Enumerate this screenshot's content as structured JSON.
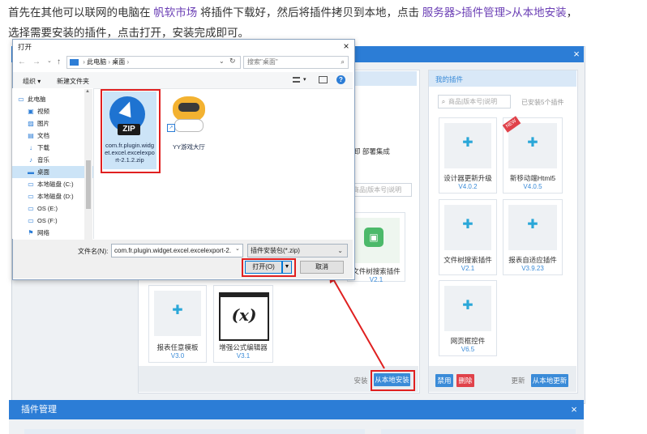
{
  "instruction": {
    "line1_prefix": "首先在其他可以联网的电脑在",
    "link_market": "帆软市场",
    "line1_mid": "将插件下载好，然后将插件拷贝到本地，点击",
    "link_path": "服务器>插件管理>从本地安装",
    "line1_suffix": "，",
    "line2": "选择需要安装的插件，点击打开，安装完成即可。"
  },
  "plugin_manager": {
    "title": "插件管理",
    "my_plugins_title": "我的插件",
    "search_placeholder": "商品|版本号|说明",
    "installed_count": "已安装5个插件",
    "left_partial_text": "卸 部署集成",
    "left_search_placeholder": "商品|版本号|说明",
    "left_plugins": [
      {
        "name": "文件树搜索插件",
        "version": "V2.1"
      },
      {
        "name": "报表任意模板",
        "version": "V3.0"
      },
      {
        "name": "增强公式编辑器",
        "version": "V3.1"
      }
    ],
    "my_plugins": [
      {
        "name": "设计器更新升级",
        "version": "V4.0.2"
      },
      {
        "name": "新移动端Html5",
        "version": "V4.0.5",
        "badge": "NEW"
      },
      {
        "name": "文件树搜索插件",
        "version": "V2.1"
      },
      {
        "name": "报表自适应插件",
        "version": "V3.9.23"
      },
      {
        "name": "网页框控件",
        "version": "V6.5"
      }
    ],
    "buttons": {
      "install": "安装",
      "install_local": "从本地安装",
      "disable": "禁用",
      "delete": "删除",
      "update": "更新",
      "update_local": "从本地更新"
    },
    "bottom_title": "插件管理",
    "close": "×"
  },
  "dialog": {
    "title": "打开",
    "close": "×",
    "nav_back": "←",
    "nav_forward": "→",
    "nav_up": "↑",
    "breadcrumb": [
      "此电脑",
      "桌面"
    ],
    "search_placeholder": "搜索\"桌面\"",
    "organize": "组织 ▾",
    "new_folder": "新建文件夹",
    "nav_items": [
      {
        "label": "此电脑",
        "icon": "computer-icon"
      },
      {
        "label": "视频",
        "icon": "video-icon"
      },
      {
        "label": "图片",
        "icon": "picture-icon"
      },
      {
        "label": "文档",
        "icon": "document-icon"
      },
      {
        "label": "下载",
        "icon": "download-icon"
      },
      {
        "label": "音乐",
        "icon": "music-icon"
      },
      {
        "label": "桌面",
        "icon": "desktop-icon",
        "selected": true
      },
      {
        "label": "本地磁盘 (C:)",
        "icon": "drive-icon"
      },
      {
        "label": "本地磁盘 (D:)",
        "icon": "drive-icon"
      },
      {
        "label": "OS (E:)",
        "icon": "drive-icon"
      },
      {
        "label": "OS (F:)",
        "icon": "drive-icon"
      },
      {
        "label": "网络",
        "icon": "network-icon"
      }
    ],
    "files": [
      {
        "name": "com.fr.plugin.widget.excel.excelexport-2.1.2.zip",
        "icon": "zip-icon",
        "badge": "ZIP",
        "selected": true
      },
      {
        "name": "YY游戏大厅",
        "icon": "game-shortcut-icon"
      }
    ],
    "filename_label": "文件名(N):",
    "filename_value": "com.fr.plugin.widget.excel.excelexport-2.",
    "filetype_value": "插件安装包(*.zip)",
    "open_button": "打开(O)",
    "cancel_button": "取消"
  },
  "colors": {
    "accent_blue": "#2c7dd6",
    "highlight_red": "#e02020",
    "link_purple": "#6b3fb5"
  }
}
